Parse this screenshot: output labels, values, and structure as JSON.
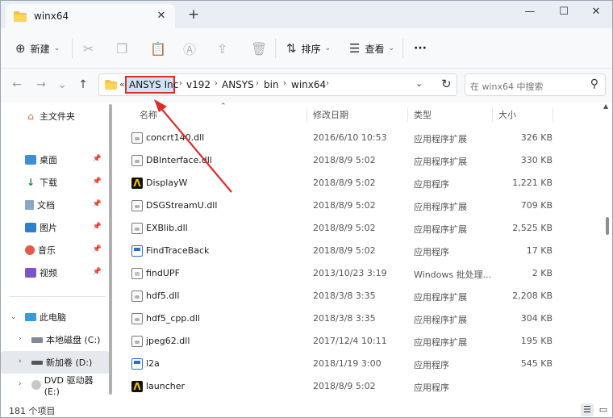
{
  "tab": {
    "title": "winx64",
    "close": "✕",
    "add": "+"
  },
  "window_controls": {
    "minimize": "—",
    "maximize": "☐",
    "close": "✕"
  },
  "toolbar": {
    "new_label": "新建",
    "sort_label": "排序",
    "view_label": "查看",
    "more": "···"
  },
  "nav": {
    "back": "←",
    "forward": "→",
    "up": "↑"
  },
  "address": {
    "more": "«",
    "crumbs": [
      "ANSYS Inc",
      "v192",
      "ANSYS",
      "bin",
      "winx64"
    ],
    "sep": "›",
    "dropdown": "⌄",
    "refresh": "↻"
  },
  "search": {
    "placeholder": "在 winx64 中搜索"
  },
  "sidebar": {
    "home": "主文件夹",
    "quick": [
      {
        "label": "桌面"
      },
      {
        "label": "下载"
      },
      {
        "label": "文档"
      },
      {
        "label": "图片"
      },
      {
        "label": "音乐"
      },
      {
        "label": "视频"
      }
    ],
    "this_pc": "此电脑",
    "drives": [
      {
        "label": "本地磁盘 (C:)"
      },
      {
        "label": "新加卷 (D:)"
      },
      {
        "label": "DVD 驱动器 (E:)"
      }
    ]
  },
  "columns": {
    "name": "名称",
    "date": "修改日期",
    "type": "类型",
    "size": "大小"
  },
  "files": [
    {
      "name": "concrt140.dll",
      "date": "2016/6/10 10:53",
      "type": "应用程序扩展",
      "size": "326 KB",
      "icon": "dll-icon"
    },
    {
      "name": "DBInterface.dll",
      "date": "2018/8/9 5:02",
      "type": "应用程序扩展",
      "size": "330 KB",
      "icon": "dll-icon"
    },
    {
      "name": "DisplayW",
      "date": "2018/8/9 5:02",
      "type": "应用程序",
      "size": "1,221 KB",
      "icon": "ansys-exe-icon"
    },
    {
      "name": "DSGStreamU.dll",
      "date": "2018/8/9 5:02",
      "type": "应用程序扩展",
      "size": "709 KB",
      "icon": "dll-icon"
    },
    {
      "name": "EXBlib.dll",
      "date": "2018/8/9 5:02",
      "type": "应用程序扩展",
      "size": "2,525 KB",
      "icon": "dll-icon"
    },
    {
      "name": "FindTraceBack",
      "date": "2018/8/9 5:02",
      "type": "应用程序",
      "size": "17 KB",
      "icon": "exe-icon"
    },
    {
      "name": "findUPF",
      "date": "2013/10/23 3:19",
      "type": "Windows 批处理...",
      "size": "2 KB",
      "icon": "batch-icon"
    },
    {
      "name": "hdf5.dll",
      "date": "2018/3/8 3:35",
      "type": "应用程序扩展",
      "size": "2,208 KB",
      "icon": "dll-icon"
    },
    {
      "name": "hdf5_cpp.dll",
      "date": "2018/3/8 3:35",
      "type": "应用程序扩展",
      "size": "304 KB",
      "icon": "dll-icon"
    },
    {
      "name": "jpeg62.dll",
      "date": "2017/12/4 10:11",
      "type": "应用程序扩展",
      "size": "195 KB",
      "icon": "dll-icon"
    },
    {
      "name": "l2a",
      "date": "2018/1/19 3:00",
      "type": "应用程序",
      "size": "545 KB",
      "icon": "exe-icon"
    },
    {
      "name": "launcher",
      "date": "2018/8/9 5:02",
      "type": "应用程序",
      "size": "",
      "icon": "ansys-exe-icon"
    }
  ],
  "status": {
    "count": "181 个项目"
  },
  "colors": {
    "accent": "#e02b2b",
    "selection": "#cfe3f7"
  }
}
